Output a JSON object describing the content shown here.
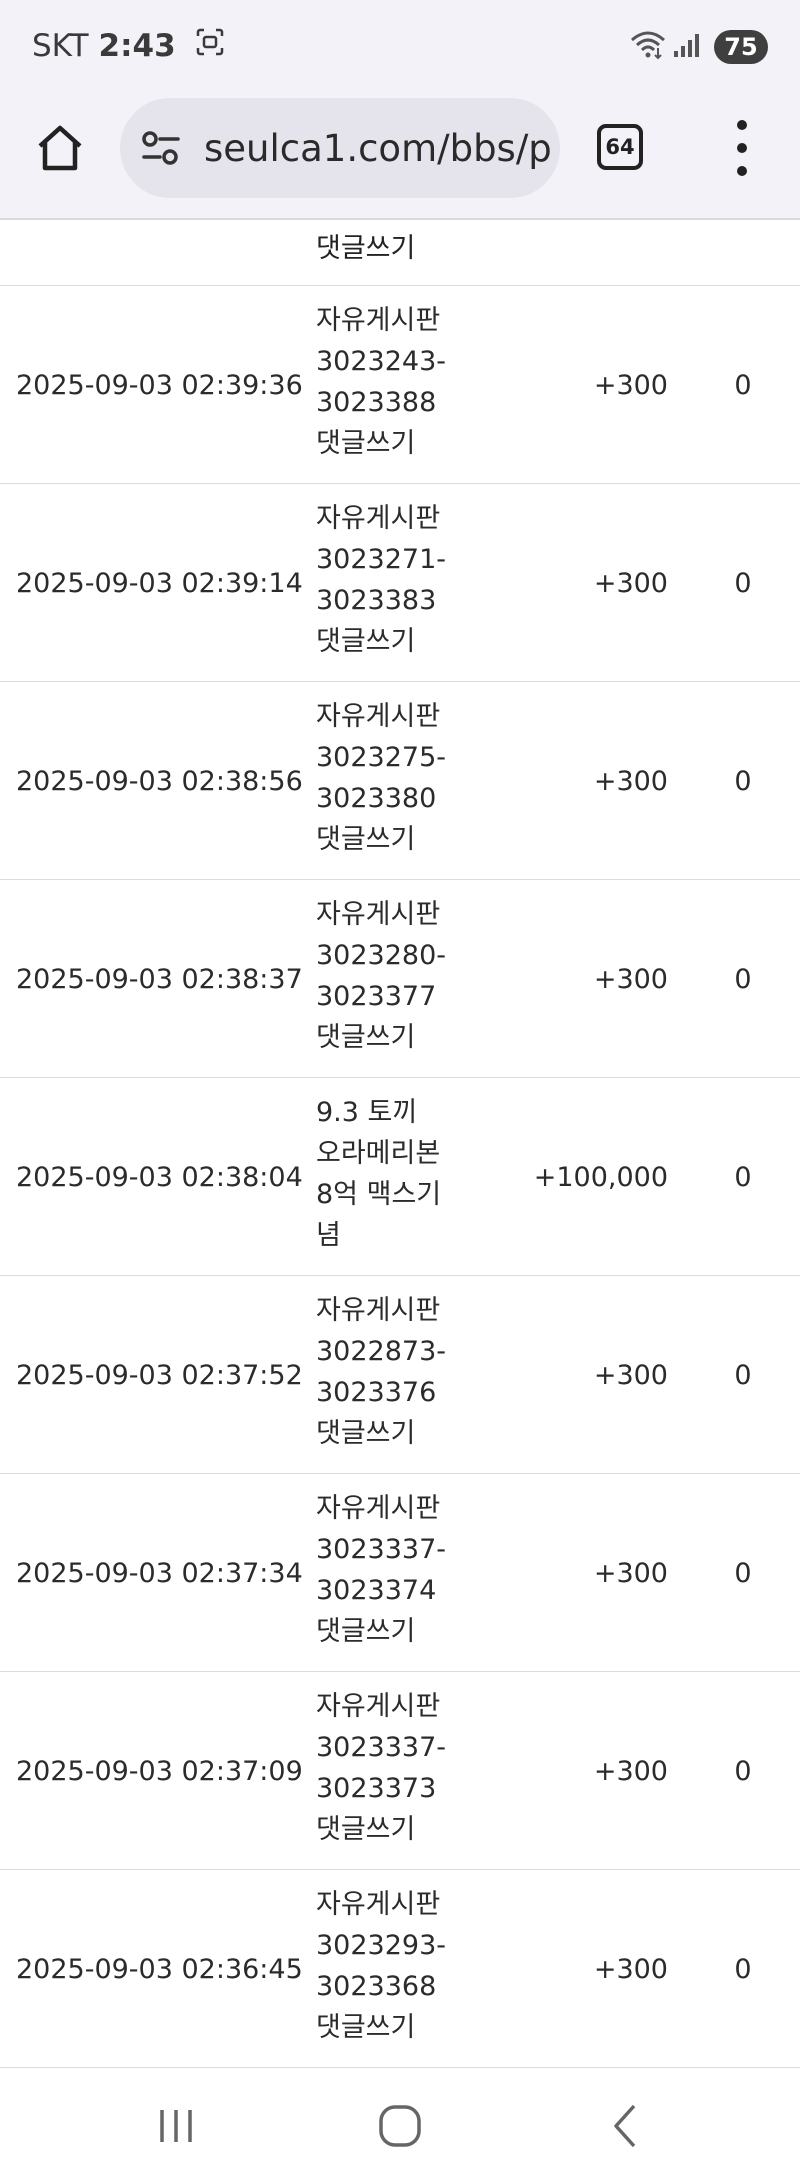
{
  "status_bar": {
    "carrier": "SKT",
    "time": "2:43",
    "battery": "75"
  },
  "browser": {
    "url": "seulca1.com/bbs/p",
    "tab_count": "64"
  },
  "partial_row": {
    "last_line": "댓글쓰기"
  },
  "rows": [
    {
      "date": "2025-09-03 02:39:36",
      "desc": [
        "자유게시판",
        "3023243-",
        "3023388",
        "댓글쓰기"
      ],
      "amount": "+300",
      "used": "0"
    },
    {
      "date": "2025-09-03 02:39:14",
      "desc": [
        "자유게시판",
        "3023271-",
        "3023383",
        "댓글쓰기"
      ],
      "amount": "+300",
      "used": "0"
    },
    {
      "date": "2025-09-03 02:38:56",
      "desc": [
        "자유게시판",
        "3023275-",
        "3023380",
        "댓글쓰기"
      ],
      "amount": "+300",
      "used": "0"
    },
    {
      "date": "2025-09-03 02:38:37",
      "desc": [
        "자유게시판",
        "3023280-",
        "3023377",
        "댓글쓰기"
      ],
      "amount": "+300",
      "used": "0"
    },
    {
      "date": "2025-09-03 02:38:04",
      "desc": [
        "9.3 토끼",
        "오라메리본",
        "8억 맥스기",
        "념"
      ],
      "amount": "+100,000",
      "used": "0"
    },
    {
      "date": "2025-09-03 02:37:52",
      "desc": [
        "자유게시판",
        "3022873-",
        "3023376",
        "댓글쓰기"
      ],
      "amount": "+300",
      "used": "0"
    },
    {
      "date": "2025-09-03 02:37:34",
      "desc": [
        "자유게시판",
        "3023337-",
        "3023374",
        "댓글쓰기"
      ],
      "amount": "+300",
      "used": "0"
    },
    {
      "date": "2025-09-03 02:37:09",
      "desc": [
        "자유게시판",
        "3023337-",
        "3023373",
        "댓글쓰기"
      ],
      "amount": "+300",
      "used": "0"
    },
    {
      "date": "2025-09-03 02:36:45",
      "desc": [
        "자유게시판",
        "3023293-",
        "3023368",
        "댓글쓰기"
      ],
      "amount": "+300",
      "used": "0"
    }
  ]
}
